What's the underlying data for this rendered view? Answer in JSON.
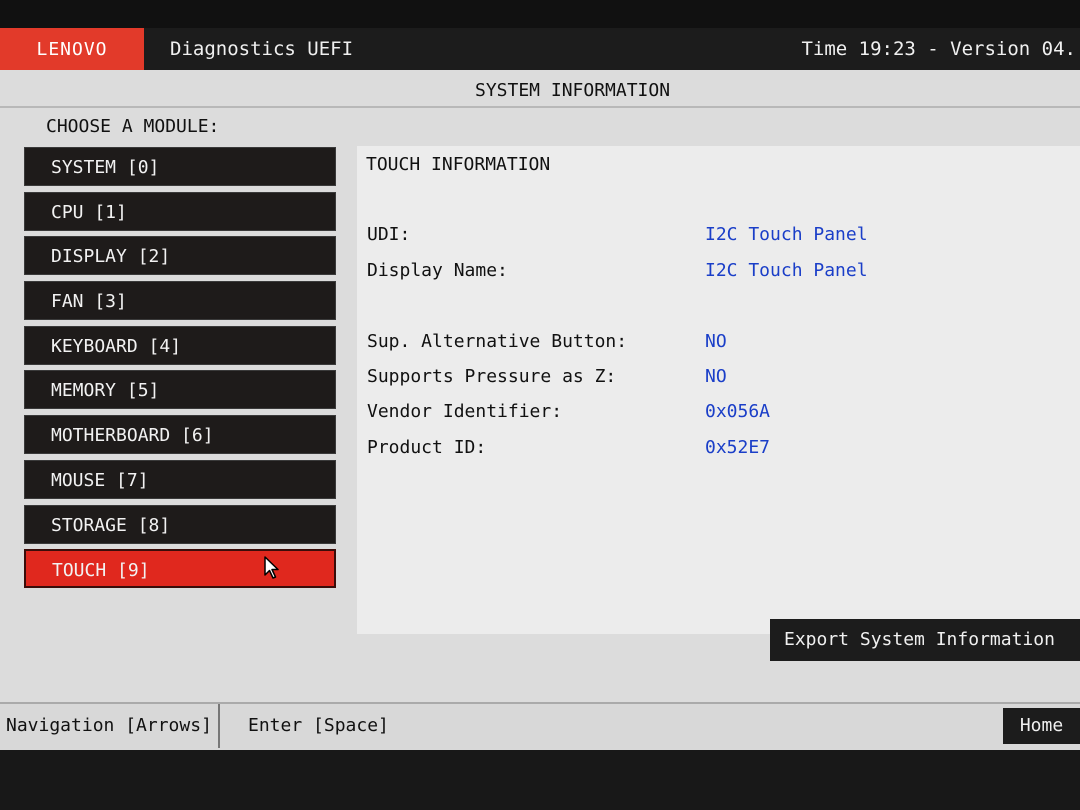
{
  "header": {
    "brand": "LENOVO",
    "app_title": "Diagnostics UEFI",
    "time_version": "Time 19:23 - Version 04.",
    "brand_color": "#e23a2a"
  },
  "section_title": "SYSTEM INFORMATION",
  "choose_label": "CHOOSE A MODULE:",
  "modules": [
    {
      "label": "SYSTEM [0]"
    },
    {
      "label": "CPU [1]"
    },
    {
      "label": "DISPLAY [2]"
    },
    {
      "label": "FAN [3]"
    },
    {
      "label": "KEYBOARD [4]"
    },
    {
      "label": "MEMORY [5]"
    },
    {
      "label": "MOTHERBOARD [6]"
    },
    {
      "label": "MOUSE [7]"
    },
    {
      "label": "STORAGE [8]"
    },
    {
      "label": "TOUCH [9]",
      "selected": true
    }
  ],
  "info": {
    "title": "TOUCH INFORMATION",
    "rows": [
      {
        "key": "UDI:",
        "value": "I2C Touch Panel"
      },
      {
        "key": "Display Name:",
        "value": "I2C Touch Panel"
      },
      {
        "key": "Sup. Alternative Button:",
        "value": "NO"
      },
      {
        "key": "Supports Pressure as Z:",
        "value": "NO"
      },
      {
        "key": "Vendor Identifier:",
        "value": "0x056A"
      },
      {
        "key": "Product ID:",
        "value": "0x52E7"
      }
    ],
    "value_color": "#1a3ec8"
  },
  "buttons": {
    "export": "Export System Information",
    "home": "Home"
  },
  "footer": {
    "navigation": "Navigation [Arrows]",
    "enter": "Enter [Space]"
  },
  "icons": {
    "cursor": "mouse-pointer-icon"
  }
}
